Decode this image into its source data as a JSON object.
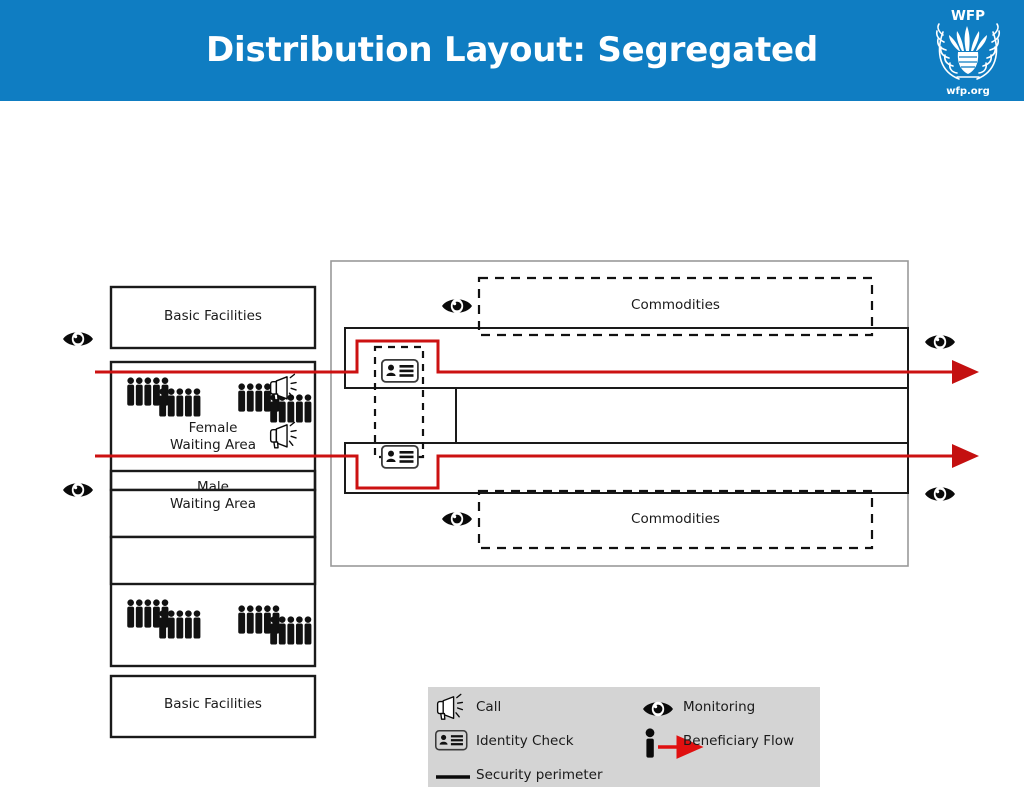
{
  "header": {
    "title": "Distribution Layout: Segregated",
    "bg_color": "#0f7dc2",
    "logo": {
      "name": "wfp-logo",
      "top_text": "WFP",
      "bottom_text": "wfp.org"
    }
  },
  "diagram": {
    "colors": {
      "flow_red": "#d32020",
      "outline_black": "#1a1a1a",
      "outline_grey": "#999999",
      "legend_bg": "#d4d4d4"
    },
    "boxes": {
      "basic_facilities_top": "Basic Facilities",
      "basic_facilities_bottom": "Basic Facilities",
      "female_waiting_area": "Female\nWaiting Area",
      "male_waiting_area": "Male\nWaiting Area",
      "commodities_top": "Commodities",
      "commodities_bottom": "Commodities"
    },
    "icons": {
      "monitoring_left_top": "eye-icon",
      "monitoring_left_bottom": "eye-icon",
      "monitoring_right_top": "eye-icon",
      "monitoring_right_bottom": "eye-icon",
      "monitoring_commodities_top": "eye-icon",
      "monitoring_commodities_bottom": "eye-icon",
      "call_top": "megaphone-icon",
      "call_bottom": "megaphone-icon",
      "identity_check_top": "id-card-icon",
      "identity_check_bottom": "id-card-icon",
      "crowd_female_left": "crowd-icon",
      "crowd_female_right": "crowd-icon",
      "crowd_male_left": "crowd-icon",
      "crowd_male_right": "crowd-icon"
    }
  },
  "legend": {
    "items": [
      {
        "icon": "megaphone-icon",
        "label": "Call"
      },
      {
        "icon": "id-card-icon",
        "label": "Identity Check"
      },
      {
        "icon": "security-line-icon",
        "label": "Security perimeter"
      },
      {
        "icon": "eye-icon",
        "label": "Monitoring"
      },
      {
        "icon": "person-arrow-icon",
        "label": "Beneficiary Flow"
      }
    ]
  }
}
